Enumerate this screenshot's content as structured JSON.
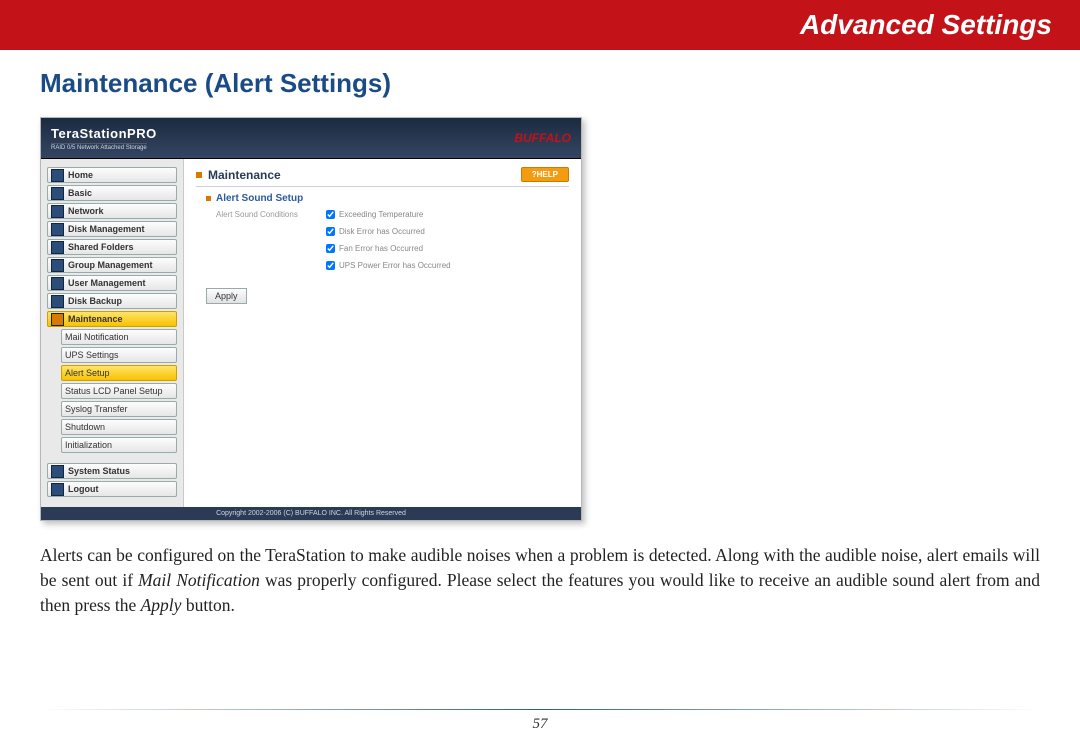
{
  "banner": {
    "title": "Advanced Settings"
  },
  "section": {
    "title": "Maintenance (Alert Settings)"
  },
  "screenshot": {
    "product": "TeraStationPRO",
    "tagline": "RAID 0/5 Network Attached Storage",
    "brand": "BUFFALO",
    "nav": {
      "main": [
        "Home",
        "Basic",
        "Network",
        "Disk Management",
        "Shared Folders",
        "Group Management",
        "User Management",
        "Disk Backup",
        "Maintenance"
      ],
      "sub": [
        "Mail Notification",
        "UPS Settings",
        "Alert Setup",
        "Status LCD Panel Setup",
        "Syslog Transfer",
        "Shutdown",
        "Initialization"
      ],
      "tail": [
        "System Status",
        "Logout"
      ],
      "active_main": "Maintenance",
      "active_sub": "Alert Setup"
    },
    "panel": {
      "title": "Maintenance",
      "help": "?HELP",
      "subsection": "Alert Sound Setup",
      "row_label": "Alert Sound Conditions",
      "options": [
        "Exceeding Temperature",
        "Disk Error has Occurred",
        "Fan Error has Occurred",
        "UPS Power Error has Occurred"
      ],
      "apply": "Apply"
    },
    "footer": "Copyright 2002-2006 (C) BUFFALO INC. All Rights Reserved"
  },
  "body": {
    "p1a": "Alerts can be configured on the TeraStation to make audible noises when a problem is detected. Along with the audible noise, alert emails will be sent out if ",
    "p1b": "Mail Notification",
    "p1c": " was properly configured. Please select the features you would like to receive an audible sound alert from and then press the ",
    "p1d": "Apply",
    "p1e": " button."
  },
  "page_number": "57"
}
